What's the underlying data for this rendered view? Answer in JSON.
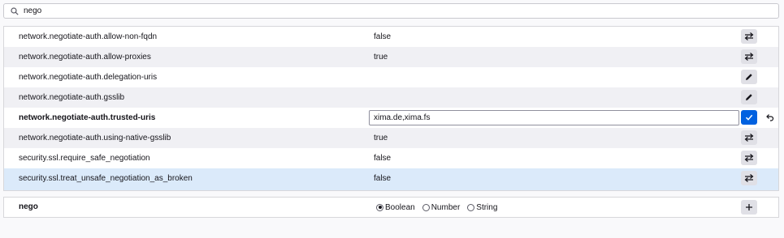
{
  "search": {
    "value": "nego",
    "icon": "search-icon"
  },
  "prefs": [
    {
      "name": "network.negotiate-auth.allow-non-fqdn",
      "value": "false",
      "action": "toggle-icon"
    },
    {
      "name": "network.negotiate-auth.allow-proxies",
      "value": "true",
      "action": "toggle-icon"
    },
    {
      "name": "network.negotiate-auth.delegation-uris",
      "value": "",
      "action": "edit-icon"
    },
    {
      "name": "network.negotiate-auth.gsslib",
      "value": "",
      "action": "edit-icon"
    },
    {
      "name": "network.negotiate-auth.trusted-uris",
      "value": "xima.de,xima.fs",
      "action": "save-icon",
      "editing": true
    },
    {
      "name": "network.negotiate-auth.using-native-gsslib",
      "value": "true",
      "action": "toggle-icon"
    },
    {
      "name": "security.ssl.require_safe_negotiation",
      "value": "false",
      "action": "toggle-icon"
    },
    {
      "name": "security.ssl.treat_unsafe_negotiation_as_broken",
      "value": "false",
      "action": "toggle-icon",
      "selected": true
    }
  ],
  "add_row": {
    "name": "nego",
    "types": [
      "Boolean",
      "Number",
      "String"
    ],
    "selected_type": "Boolean",
    "action": "add-icon"
  },
  "colors": {
    "accent": "#0061e0",
    "selected_row": "#dbeafa",
    "alt_row": "#f0f0f4"
  }
}
